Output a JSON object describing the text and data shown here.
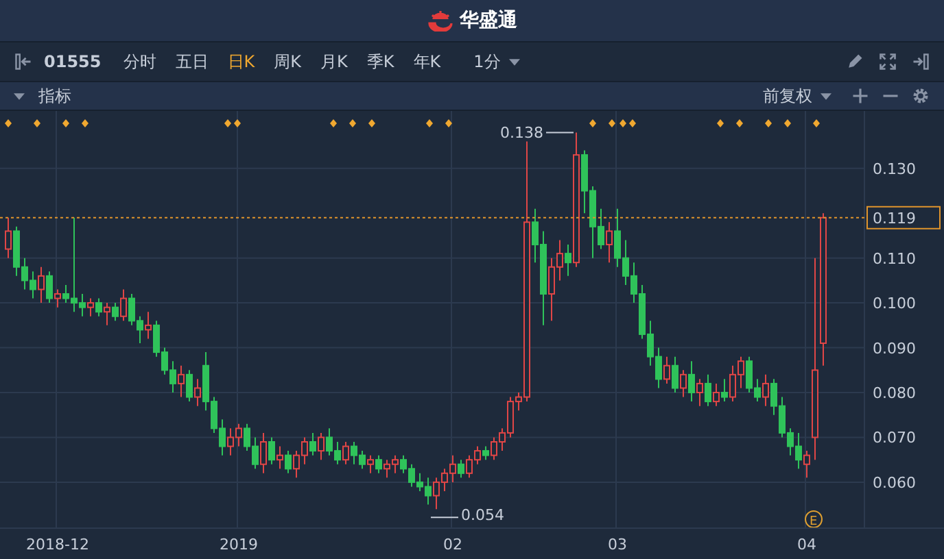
{
  "header": {
    "brand": "华盛通"
  },
  "toolbar": {
    "code": "01555",
    "periods": [
      {
        "label": "分时",
        "selected": false
      },
      {
        "label": "五日",
        "selected": false
      },
      {
        "label": "日K",
        "selected": true
      },
      {
        "label": "周K",
        "selected": false
      },
      {
        "label": "月K",
        "selected": false
      },
      {
        "label": "季K",
        "selected": false
      },
      {
        "label": "年K",
        "selected": false
      }
    ],
    "interval": "1分"
  },
  "indicator_bar": {
    "label": "指标",
    "adjust": "前复权"
  },
  "chart": {
    "event_label": "E",
    "chart_data": {
      "type": "candlestick",
      "categories": [
        null,
        null,
        null,
        null,
        null,
        null,
        "2018-12",
        null,
        null,
        null,
        null,
        null,
        null,
        null,
        null,
        null,
        null,
        null,
        null,
        null,
        null,
        null,
        null,
        null,
        null,
        null,
        null,
        null,
        "2019",
        null,
        null,
        null,
        null,
        null,
        null,
        null,
        null,
        null,
        null,
        null,
        null,
        null,
        null,
        null,
        null,
        null,
        null,
        null,
        null,
        null,
        null,
        null,
        null,
        null,
        "02",
        null,
        null,
        null,
        null,
        null,
        null,
        null,
        null,
        null,
        null,
        null,
        null,
        null,
        null,
        null,
        null,
        null,
        null,
        null,
        "03",
        null,
        null,
        null,
        null,
        null,
        null,
        null,
        null,
        null,
        null,
        null,
        null,
        null,
        null,
        null,
        null,
        null,
        null,
        null,
        null,
        null,
        null,
        "04",
        null,
        null
      ],
      "ylim": [
        0.0499,
        0.1428
      ],
      "ohlc": [
        [
          0.112,
          0.119,
          0.11,
          0.116
        ],
        [
          0.116,
          0.117,
          0.106,
          0.108
        ],
        [
          0.108,
          0.11,
          0.103,
          0.105
        ],
        [
          0.105,
          0.107,
          0.101,
          0.103
        ],
        [
          0.103,
          0.108,
          0.1,
          0.106
        ],
        [
          0.106,
          0.107,
          0.1,
          0.101
        ],
        [
          0.101,
          0.103,
          0.099,
          0.102
        ],
        [
          0.102,
          0.104,
          0.1,
          0.101
        ],
        [
          0.101,
          0.119,
          0.098,
          0.1
        ],
        [
          0.1,
          0.102,
          0.097,
          0.099
        ],
        [
          0.099,
          0.101,
          0.097,
          0.1
        ],
        [
          0.1,
          0.101,
          0.097,
          0.098
        ],
        [
          0.098,
          0.1,
          0.095,
          0.099
        ],
        [
          0.099,
          0.1,
          0.096,
          0.097
        ],
        [
          0.097,
          0.103,
          0.096,
          0.101
        ],
        [
          0.101,
          0.102,
          0.095,
          0.096
        ],
        [
          0.096,
          0.097,
          0.091,
          0.094
        ],
        [
          0.094,
          0.098,
          0.092,
          0.095
        ],
        [
          0.095,
          0.096,
          0.088,
          0.089
        ],
        [
          0.089,
          0.09,
          0.084,
          0.085
        ],
        [
          0.085,
          0.087,
          0.08,
          0.082
        ],
        [
          0.082,
          0.086,
          0.079,
          0.084
        ],
        [
          0.084,
          0.085,
          0.078,
          0.079
        ],
        [
          0.079,
          0.083,
          0.077,
          0.081
        ],
        [
          0.086,
          0.089,
          0.076,
          0.078
        ],
        [
          0.078,
          0.079,
          0.071,
          0.072
        ],
        [
          0.072,
          0.074,
          0.066,
          0.068
        ],
        [
          0.068,
          0.072,
          0.066,
          0.07
        ],
        [
          0.07,
          0.073,
          0.068,
          0.072
        ],
        [
          0.072,
          0.073,
          0.067,
          0.068
        ],
        [
          0.068,
          0.07,
          0.063,
          0.064
        ],
        [
          0.064,
          0.071,
          0.062,
          0.069
        ],
        [
          0.069,
          0.07,
          0.064,
          0.065
        ],
        [
          0.065,
          0.068,
          0.063,
          0.066
        ],
        [
          0.066,
          0.067,
          0.062,
          0.063
        ],
        [
          0.063,
          0.067,
          0.061,
          0.066
        ],
        [
          0.066,
          0.07,
          0.064,
          0.069
        ],
        [
          0.069,
          0.071,
          0.066,
          0.067
        ],
        [
          0.067,
          0.071,
          0.065,
          0.07
        ],
        [
          0.07,
          0.072,
          0.066,
          0.067
        ],
        [
          0.067,
          0.069,
          0.064,
          0.065
        ],
        [
          0.065,
          0.069,
          0.064,
          0.068
        ],
        [
          0.068,
          0.069,
          0.064,
          0.066
        ],
        [
          0.066,
          0.067,
          0.063,
          0.064
        ],
        [
          0.064,
          0.066,
          0.062,
          0.065
        ],
        [
          0.065,
          0.066,
          0.062,
          0.063
        ],
        [
          0.063,
          0.065,
          0.061,
          0.064
        ],
        [
          0.064,
          0.066,
          0.062,
          0.065
        ],
        [
          0.065,
          0.066,
          0.062,
          0.063
        ],
        [
          0.063,
          0.064,
          0.059,
          0.06
        ],
        [
          0.06,
          0.062,
          0.058,
          0.059
        ],
        [
          0.059,
          0.061,
          0.055,
          0.057
        ],
        [
          0.057,
          0.061,
          0.054,
          0.06
        ],
        [
          0.06,
          0.063,
          0.058,
          0.062
        ],
        [
          0.062,
          0.066,
          0.06,
          0.064
        ],
        [
          0.064,
          0.065,
          0.061,
          0.062
        ],
        [
          0.062,
          0.066,
          0.061,
          0.065
        ],
        [
          0.065,
          0.068,
          0.064,
          0.067
        ],
        [
          0.067,
          0.068,
          0.065,
          0.066
        ],
        [
          0.066,
          0.07,
          0.065,
          0.069
        ],
        [
          0.069,
          0.072,
          0.067,
          0.071
        ],
        [
          0.071,
          0.079,
          0.07,
          0.078
        ],
        [
          0.078,
          0.08,
          0.076,
          0.079
        ],
        [
          0.079,
          0.136,
          0.078,
          0.118
        ],
        [
          0.118,
          0.121,
          0.109,
          0.113
        ],
        [
          0.113,
          0.116,
          0.095,
          0.102
        ],
        [
          0.102,
          0.11,
          0.096,
          0.108
        ],
        [
          0.108,
          0.114,
          0.105,
          0.111
        ],
        [
          0.111,
          0.113,
          0.106,
          0.109
        ],
        [
          0.109,
          0.138,
          0.108,
          0.133
        ],
        [
          0.133,
          0.134,
          0.12,
          0.125
        ],
        [
          0.125,
          0.126,
          0.11,
          0.117
        ],
        [
          0.117,
          0.121,
          0.112,
          0.113
        ],
        [
          0.113,
          0.118,
          0.109,
          0.116
        ],
        [
          0.116,
          0.121,
          0.108,
          0.11
        ],
        [
          0.11,
          0.114,
          0.104,
          0.106
        ],
        [
          0.106,
          0.109,
          0.1,
          0.102
        ],
        [
          0.102,
          0.104,
          0.092,
          0.093
        ],
        [
          0.093,
          0.096,
          0.086,
          0.088
        ],
        [
          0.088,
          0.09,
          0.081,
          0.083
        ],
        [
          0.083,
          0.088,
          0.082,
          0.086
        ],
        [
          0.086,
          0.088,
          0.08,
          0.081
        ],
        [
          0.081,
          0.085,
          0.079,
          0.084
        ],
        [
          0.084,
          0.087,
          0.078,
          0.08
        ],
        [
          0.08,
          0.083,
          0.077,
          0.082
        ],
        [
          0.082,
          0.084,
          0.077,
          0.078
        ],
        [
          0.078,
          0.082,
          0.077,
          0.08
        ],
        [
          0.08,
          0.083,
          0.078,
          0.079
        ],
        [
          0.079,
          0.086,
          0.078,
          0.084
        ],
        [
          0.084,
          0.088,
          0.081,
          0.087
        ],
        [
          0.087,
          0.088,
          0.08,
          0.081
        ],
        [
          0.081,
          0.083,
          0.078,
          0.079
        ],
        [
          0.079,
          0.084,
          0.077,
          0.082
        ],
        [
          0.082,
          0.083,
          0.075,
          0.077
        ],
        [
          0.077,
          0.079,
          0.07,
          0.071
        ],
        [
          0.071,
          0.072,
          0.066,
          0.068
        ],
        [
          0.068,
          0.071,
          0.063,
          0.065
        ],
        [
          0.064,
          0.067,
          0.061,
          0.066
        ],
        [
          0.07,
          0.11,
          0.065,
          0.085
        ],
        [
          0.091,
          0.12,
          0.086,
          0.119
        ]
      ],
      "yticks": [
        {
          "value": 0.13,
          "label": "0.130"
        },
        {
          "value": 0.11,
          "label": "0.110"
        },
        {
          "value": 0.1,
          "label": "0.100"
        },
        {
          "value": 0.09,
          "label": "0.090"
        },
        {
          "value": 0.08,
          "label": "0.080"
        },
        {
          "value": 0.07,
          "label": "0.070"
        },
        {
          "value": 0.06,
          "label": "0.060"
        }
      ],
      "grid": true,
      "annotations": [
        "0.138",
        "0.054"
      ],
      "ref_lines": [
        {
          "axis": "y",
          "value": 0.119,
          "label": "0.119",
          "color": "#e0942c"
        }
      ]
    }
  }
}
